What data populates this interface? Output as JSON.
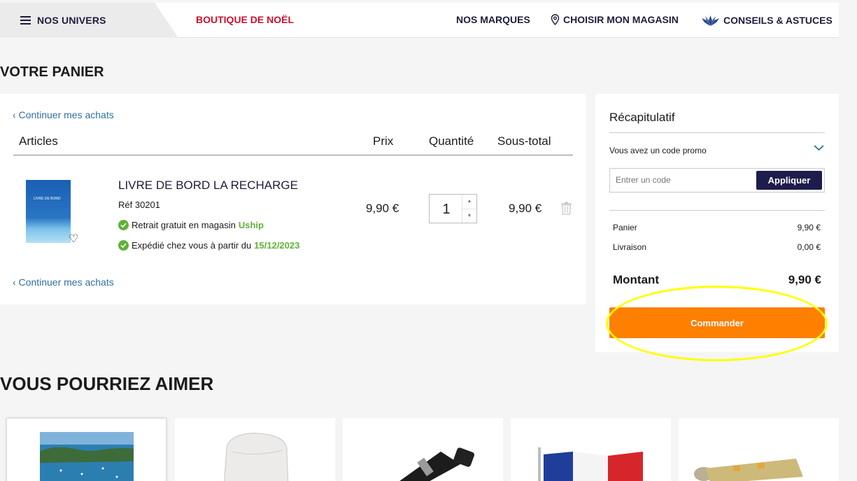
{
  "nav": {
    "univers": "NOS UNIVERS",
    "noel": "BOUTIQUE DE NOËL",
    "marques": "NOS MARQUES",
    "magasin": "CHOISIR MON MAGASIN",
    "conseils": "CONSEILS & ASTUCES"
  },
  "cart": {
    "title": "VOTRE PANIER",
    "continue_label": "‹ Continuer mes achats",
    "headers": {
      "articles": "Articles",
      "prix": "Prix",
      "quantite": "Quantité",
      "sous_total": "Sous-total"
    },
    "item": {
      "thumb_text": "LIVRE DE BORD",
      "name": "LIVRE DE BORD LA RECHARGE",
      "ref": "Réf 30201",
      "retrait_text": "Retrait gratuit en magasin",
      "retrait_store": "Uship",
      "expedie_text": "Expédié chez vous à partir du",
      "expedie_date": "15/12/2023",
      "price": "9,90 €",
      "quantity": "1",
      "subtotal": "9,90 €"
    }
  },
  "summary": {
    "title": "Récapitulatif",
    "promo_label": "Vous avez un code promo",
    "promo_placeholder": "Entrer un code",
    "promo_button": "Appliquer",
    "panier_label": "Panier",
    "panier_value": "9,90 €",
    "livraison_label": "Livraison",
    "livraison_value": "0,00 €",
    "montant_label": "Montant",
    "montant_value": "9,90 €",
    "commander": "Commander"
  },
  "reco": {
    "title": "VOUS POURRIEZ AIMER"
  },
  "colors": {
    "accent": "#ff7f00",
    "navy": "#1d1d4d",
    "noel": "#c8102e",
    "success": "#5fb236",
    "highlight": "#ffff00"
  }
}
